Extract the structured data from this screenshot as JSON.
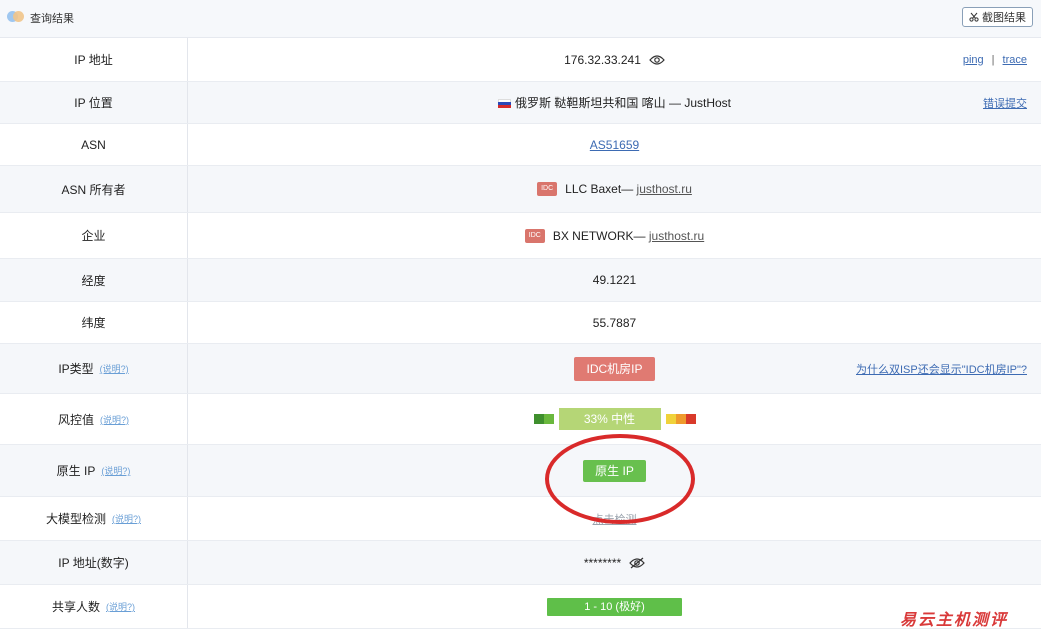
{
  "header": {
    "title": "查询结果",
    "screenshot_label": "截图结果"
  },
  "rows": {
    "ip": {
      "label": "IP 地址",
      "value": "176.32.33.241",
      "ping": "ping",
      "separator": "|",
      "trace": "trace"
    },
    "location": {
      "label": "IP 位置",
      "value": "俄罗斯 鞑靼斯坦共和国 喀山 — JustHost",
      "report": "错误提交"
    },
    "asn": {
      "label": "ASN",
      "value": "AS51659"
    },
    "asn_owner": {
      "label": "ASN 所有者",
      "tag": "IDC",
      "name": "LLC Baxet— ",
      "domain": "justhost.ru"
    },
    "company": {
      "label": "企业",
      "tag": "IDC",
      "name": "BX NETWORK— ",
      "domain": "justhost.ru"
    },
    "longitude": {
      "label": "经度",
      "value": "49.1221"
    },
    "latitude": {
      "label": "纬度",
      "value": "55.7887"
    },
    "ip_type": {
      "label": "IP类型",
      "help": "(说明?)",
      "value": "IDC机房IP",
      "note": "为什么双ISP还会显示\"IDC机房IP\"?"
    },
    "risk": {
      "label": "风控值",
      "help": "(说明?)",
      "value": "33%  中性",
      "percent": 33
    },
    "native": {
      "label": "原生 IP",
      "help": "(说明?)",
      "value": "原生 IP"
    },
    "llm": {
      "label": "大模型检测",
      "help": "(说明?)",
      "value": "点击检测"
    },
    "ip_numeric": {
      "label": "IP 地址(数字)",
      "value": "********"
    },
    "shared": {
      "label": "共享人数",
      "help": "(说明?)",
      "value": "1 - 10 (极好)"
    }
  },
  "watermark": "易云主机测评",
  "colors": {
    "accent_link": "#3d6bb3",
    "idc_red": "#e07a72",
    "risk_green": "#b5d676",
    "good_green": "#5fbf49",
    "annotation_red": "#d92a2a"
  },
  "icons": [
    "eye-icon",
    "eye-off-icon",
    "scissors-icon",
    "russia-flag-icon",
    "app-logo-icon"
  ]
}
